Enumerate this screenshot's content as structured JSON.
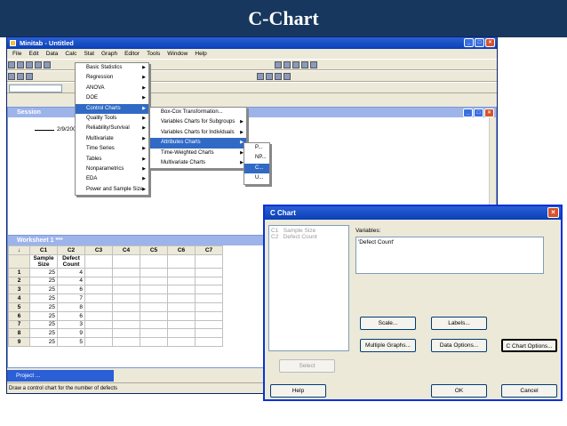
{
  "banner": {
    "title": "C-Chart"
  },
  "main": {
    "title": "Minitab - Untitled",
    "menu": [
      "File",
      "Edit",
      "Data",
      "Calc",
      "Stat",
      "Graph",
      "Editor",
      "Tools",
      "Window",
      "Help"
    ]
  },
  "session": {
    "title": "Session",
    "date": "2/9/200"
  },
  "stat_menu": [
    "Basic Statistics",
    "Regression",
    "ANOVA",
    "DOE",
    "Control Charts",
    "Quality Tools",
    "Reliability/Survival",
    "Multivariate",
    "Time Series",
    "Tables",
    "Nonparametrics",
    "EDA",
    "Power and Sample Size"
  ],
  "control_menu": [
    "Box-Cox Transformation...",
    "Variables Charts for Subgroups",
    "Variables Charts for Individuals",
    "Attributes Charts",
    "Time-Weighted Charts",
    "Multivariate Charts"
  ],
  "attr_menu": [
    "P...",
    "NP...",
    "C...",
    "U..."
  ],
  "worksheet": {
    "title": "Worksheet 1 ***",
    "cols": [
      "C1",
      "C2",
      "C3",
      "C4",
      "C5",
      "C6",
      "C7"
    ],
    "names": [
      "Sample Size",
      "Defect Count"
    ],
    "rows": [
      [
        "25",
        "4"
      ],
      [
        "25",
        "4"
      ],
      [
        "25",
        "6"
      ],
      [
        "25",
        "7"
      ],
      [
        "25",
        "8"
      ],
      [
        "25",
        "6"
      ],
      [
        "25",
        "3"
      ],
      [
        "25",
        "9"
      ],
      [
        "25",
        "5"
      ]
    ]
  },
  "project": "Project ...",
  "status": "Draw a control chart for the number of defects",
  "dialog": {
    "title": "C Chart",
    "list": [
      [
        "C1",
        "Sample Size"
      ],
      [
        "C2",
        "Defect Count"
      ]
    ],
    "variables_label": "Variables:",
    "variables_value": "'Defect Count'",
    "scale": "Scale...",
    "labels": "Labels...",
    "multiple": "Multiple Graphs...",
    "data_options": "Data Options...",
    "c_options": "C Chart Options...",
    "select": "Select",
    "help": "Help",
    "ok": "OK",
    "cancel": "Cancel"
  }
}
